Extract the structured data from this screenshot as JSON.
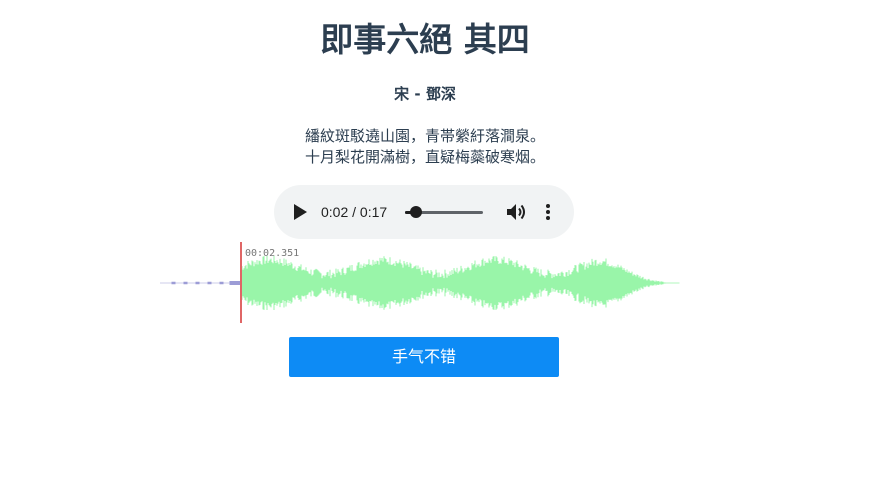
{
  "poem": {
    "title": "即事六絕 其四",
    "author": "宋 - 鄧深",
    "lines": [
      "繙紋斑駁遶山園，青帯縈紆落澗泉。",
      "十月梨花開滿樹，直疑梅蘂破寒烟。"
    ]
  },
  "player": {
    "current_time": "0:02",
    "duration": "0:17",
    "time_label": "0:02 / 0:17",
    "progress": 0.14,
    "play_icon": "play-icon",
    "volume_icon": "volume-icon",
    "menu_icon": "more-vert-icon"
  },
  "waveform": {
    "cursor_time": "00:02.351",
    "played_color": "#9c9cd6",
    "unplayed_color": "#99f5a9",
    "cursor_color": "#e06666"
  },
  "action": {
    "button_label": "手气不错",
    "button_color": "#0d8bf5"
  }
}
